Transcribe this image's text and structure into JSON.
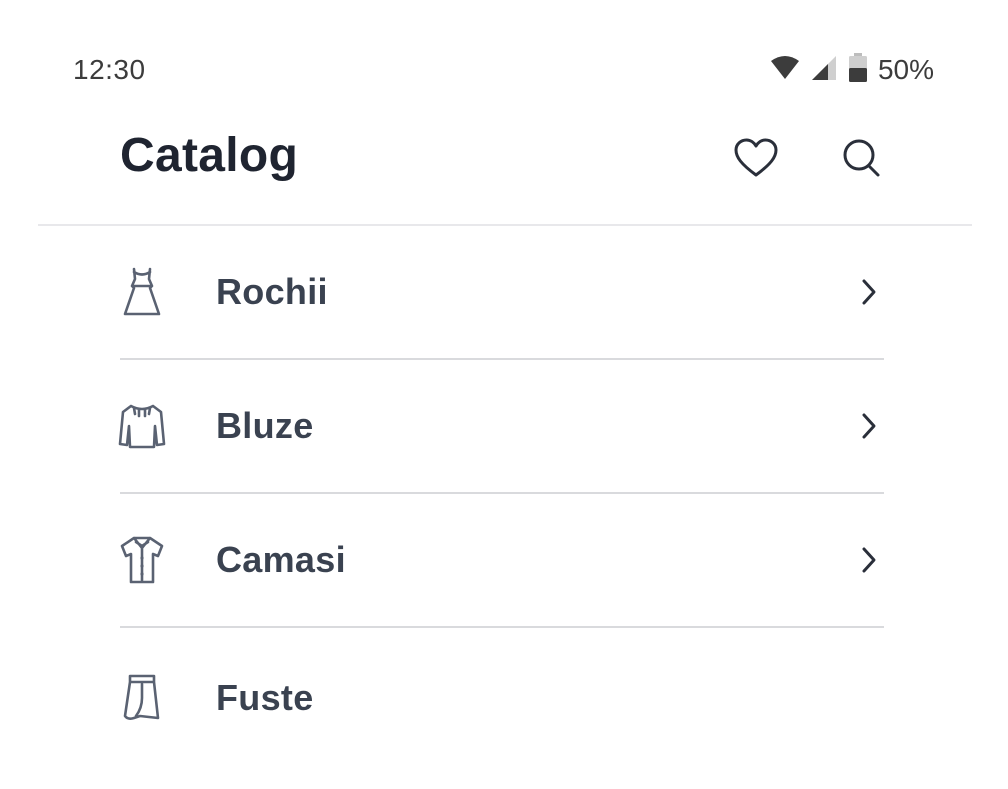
{
  "status_bar": {
    "time": "12:30",
    "battery_text": "50%",
    "icons": [
      "wifi-icon",
      "signal-icon",
      "battery-icon"
    ]
  },
  "header": {
    "title": "Catalog",
    "actions": [
      "heart-icon",
      "search-icon"
    ]
  },
  "categories": [
    {
      "label": "Rochii",
      "icon": "dress-icon",
      "has_chevron": true
    },
    {
      "label": "Bluze",
      "icon": "blouse-icon",
      "has_chevron": true
    },
    {
      "label": "Camasi",
      "icon": "shirt-icon",
      "has_chevron": true
    },
    {
      "label": "Fuste",
      "icon": "skirt-icon",
      "has_chevron": false
    }
  ],
  "colors": {
    "text_primary": "#1f2430",
    "text_item": "#3a4250",
    "icon_stroke": "#5a6272",
    "divider": "#d9dadd"
  }
}
